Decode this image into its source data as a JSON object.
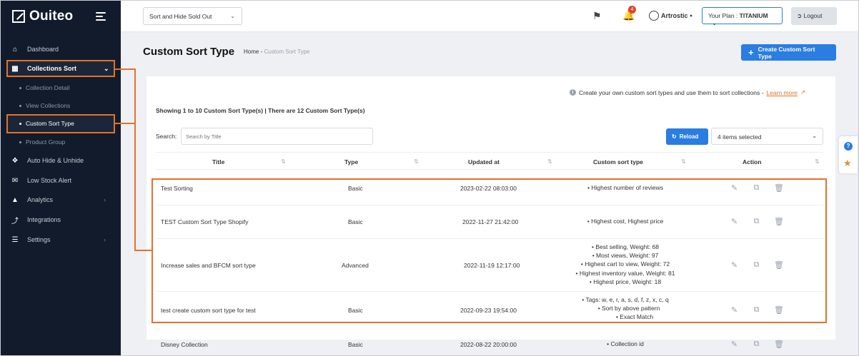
{
  "brand": {
    "name": "Ouiteo"
  },
  "sidebar": {
    "items": [
      {
        "label": "Dashboard",
        "icon": "home-icon"
      },
      {
        "label": "Collections Sort",
        "icon": "grid-icon"
      },
      {
        "label": "Auto Hide & Unhide",
        "icon": "dropbox-icon"
      },
      {
        "label": "Low Stock Alert",
        "icon": "mail-icon"
      },
      {
        "label": "Analytics",
        "icon": "chart-icon"
      },
      {
        "label": "Integrations",
        "icon": "plug-icon"
      },
      {
        "label": "Settings",
        "icon": "sliders-icon"
      }
    ],
    "sub_items": [
      "Collection Detail",
      "View Collections",
      "Custom Sort Type",
      "Product Group"
    ]
  },
  "topbar": {
    "select_value": "Sort and Hide Sold Out",
    "notification_count": "4",
    "user_name": "Artrostic",
    "plan_label": "Your Plan :",
    "plan_value": "TITANIUM",
    "logout_label": "Logout"
  },
  "page": {
    "title": "Custom Sort Type",
    "breadcrumb_home": "Home",
    "breadcrumb_sep": "-",
    "breadcrumb_current": "Custom Sort Type",
    "create_label": "Create Custom Sort Type",
    "info_text": "Create your own custom sort types and use them to sort collections -",
    "learn_more": "Learn more",
    "showing": "Showing 1 to 10 Custom Sort Type(s) | There are 12 Custom Sort Type(s)",
    "search_label": "Search:",
    "search_placeholder": "Search by Title",
    "reload_label": "Reload",
    "items_selected": "4 items selected"
  },
  "table": {
    "headers": [
      "Title",
      "Type",
      "Updated at",
      "Custom sort type",
      "Action"
    ],
    "rows": [
      {
        "title": "Test Sorting",
        "type": "Basic",
        "updated": "2023-02-22 08:03:00",
        "sort": [
          "Highest number of reviews"
        ]
      },
      {
        "title": "TEST Custom Sort Type Shopify",
        "type": "Basic",
        "updated": "2022-11-27 21:42:00",
        "sort": [
          "Highest cost, Highest price"
        ]
      },
      {
        "title": "Increase sales and BFCM sort type",
        "type": "Advanced",
        "updated": "2022-11-19 12:17:00",
        "sort": [
          "Best selling, Weight: 68",
          "Most views, Weight: 97",
          "Highest cart to view, Weight: 72",
          "Highest inventory value, Weight: 81",
          "Highest price, Weight: 18"
        ]
      },
      {
        "title": "test create custom sort type for test",
        "type": "Basic",
        "updated": "2022-09-23 19:54:00",
        "sort": [
          "Tags: w, e, r, a, s, d, f, z, x, c, q",
          "Sort by above pattern",
          "Exact Match"
        ]
      },
      {
        "title": "Disney Collection",
        "type": "Basic",
        "updated": "2022-08-22 20:00:00",
        "sort": [
          "Collection id"
        ]
      }
    ]
  },
  "colors": {
    "accent": "#2a7de1",
    "highlight": "#e2722b",
    "sidebar_bg": "#121b2b"
  }
}
